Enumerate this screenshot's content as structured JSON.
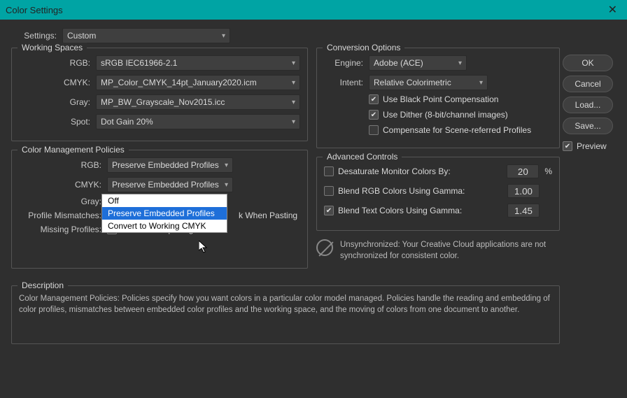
{
  "title": "Color Settings",
  "settings": {
    "label": "Settings:",
    "value": "Custom"
  },
  "working_spaces": {
    "legend": "Working Spaces",
    "rgb_label": "RGB:",
    "rgb_value": "sRGB IEC61966-2.1",
    "cmyk_label": "CMYK:",
    "cmyk_value": "MP_Color_CMYK_14pt_January2020.icm",
    "gray_label": "Gray:",
    "gray_value": "MP_BW_Grayscale_Nov2015.icc",
    "spot_label": "Spot:",
    "spot_value": "Dot Gain 20%"
  },
  "policies": {
    "legend": "Color Management Policies",
    "rgb_label": "RGB:",
    "rgb_value": "Preserve Embedded Profiles",
    "cmyk_label": "CMYK:",
    "cmyk_value": "Preserve Embedded Profiles",
    "gray_label": "Gray:",
    "dropdown": {
      "off": "Off",
      "preserve": "Preserve Embedded Profiles",
      "convert": "Convert to Working CMYK"
    },
    "mismatch_label": "Profile Mismatches:",
    "mismatch_paste": "k When Pasting",
    "missing_label": "Missing Profiles:",
    "missing_ask": "Ask When Opening"
  },
  "conversion": {
    "legend": "Conversion Options",
    "engine_label": "Engine:",
    "engine_value": "Adobe (ACE)",
    "intent_label": "Intent:",
    "intent_value": "Relative Colorimetric",
    "bpc": "Use Black Point Compensation",
    "dither": "Use Dither (8-bit/channel images)",
    "compensate": "Compensate for Scene-referred Profiles"
  },
  "advanced": {
    "legend": "Advanced Controls",
    "desat": "Desaturate Monitor Colors By:",
    "desat_val": "20",
    "pct": "%",
    "blend_rgb": "Blend RGB Colors Using Gamma:",
    "blend_rgb_val": "1.00",
    "blend_text": "Blend Text Colors Using Gamma:",
    "blend_text_val": "1.45"
  },
  "sync": "Unsynchronized: Your Creative Cloud applications are not synchronized for consistent color.",
  "description": {
    "legend": "Description",
    "text": "Color Management Policies:  Policies specify how you want colors in a particular color model managed.  Policies handle the reading and embedding of color profiles, mismatches between embedded color profiles and the working space, and the moving of colors from one document to another."
  },
  "buttons": {
    "ok": "OK",
    "cancel": "Cancel",
    "load": "Load...",
    "save": "Save..."
  },
  "preview": "Preview"
}
